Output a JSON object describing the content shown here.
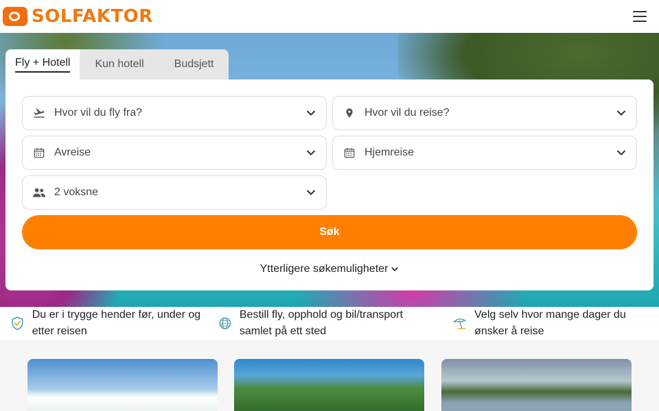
{
  "brand": {
    "name": "SOLFAKTOR",
    "accent": "#ff8000"
  },
  "tabs": [
    {
      "label": "Fly + Hotell",
      "active": true
    },
    {
      "label": "Kun hotell",
      "active": false
    },
    {
      "label": "Budsjett",
      "active": false
    }
  ],
  "search": {
    "from": {
      "placeholder": "Hvor vil du fly fra?",
      "icon": "plane-takeoff-icon"
    },
    "to": {
      "placeholder": "Hvor vil du reise?",
      "icon": "map-pin-icon"
    },
    "departure": {
      "placeholder": "Avreise",
      "icon": "calendar-icon"
    },
    "return": {
      "placeholder": "Hjemreise",
      "icon": "calendar-icon"
    },
    "travellers": {
      "value": "2 voksne",
      "icon": "people-icon"
    },
    "submit_label": "Søk",
    "more_options_label": "Ytterligere søkemuligheter"
  },
  "usps": [
    {
      "text": "Du er i trygge hender før, under og etter reisen",
      "icon": "shield-check-icon"
    },
    {
      "text": "Bestill fly, opphold og bil/transport samlet på ett sted",
      "icon": "globe-icon"
    },
    {
      "text": "Velg selv hvor mange dager du ønsker å reise",
      "icon": "beach-umbrella-icon"
    }
  ]
}
